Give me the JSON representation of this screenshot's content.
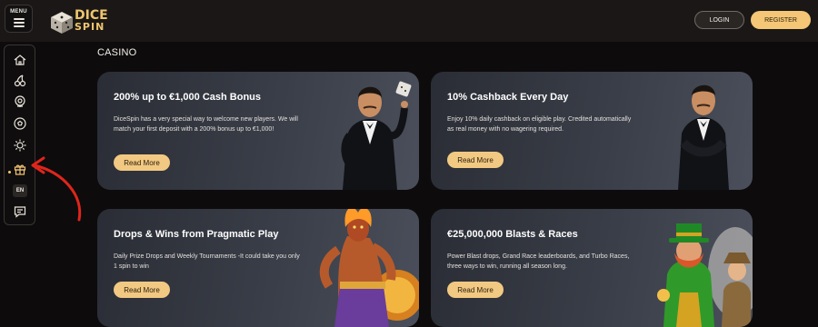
{
  "header": {
    "menu_label": "MENU",
    "logo_top": "DICE",
    "logo_bottom": "SPIN",
    "login_label": "LOGIN",
    "register_label": "REGISTER"
  },
  "sidebar": {
    "items": [
      {
        "icon": "home-icon"
      },
      {
        "icon": "cherries-icon"
      },
      {
        "icon": "roulette-icon"
      },
      {
        "icon": "football-icon"
      },
      {
        "icon": "sun-icon"
      },
      {
        "icon": "gift-icon"
      },
      {
        "icon": "support-chat-icon"
      }
    ],
    "language": "EN"
  },
  "main": {
    "section_title": "CASINO",
    "cards": [
      {
        "title": "200% up to €1,000 Cash Bonus",
        "body": "DiceSpin has a very special way to welcome new players. We will match your first deposit with a 200% bonus up to €1,000!",
        "cta": "Read More"
      },
      {
        "title": "10% Cashback Every Day",
        "body": "Enjoy 10% daily cashback on eligible play. Credited automatically as real money with no wagering required.",
        "cta": "Read More"
      },
      {
        "title": "Drops & Wins from Pragmatic Play",
        "body": "Daily Prize Drops and Weekly Tournaments -It could take you only 1 spin to win",
        "cta": "Read More"
      },
      {
        "title": "€25,000,000 Blasts & Races",
        "body": "Power Blast drops, Grand Race leaderboards, and Turbo Races, three ways to win, running all season long.",
        "cta": "Read More"
      }
    ]
  },
  "colors": {
    "accent": "#f4c675",
    "background": "#0d0b0c",
    "annotation_arrow": "#e0251b"
  }
}
